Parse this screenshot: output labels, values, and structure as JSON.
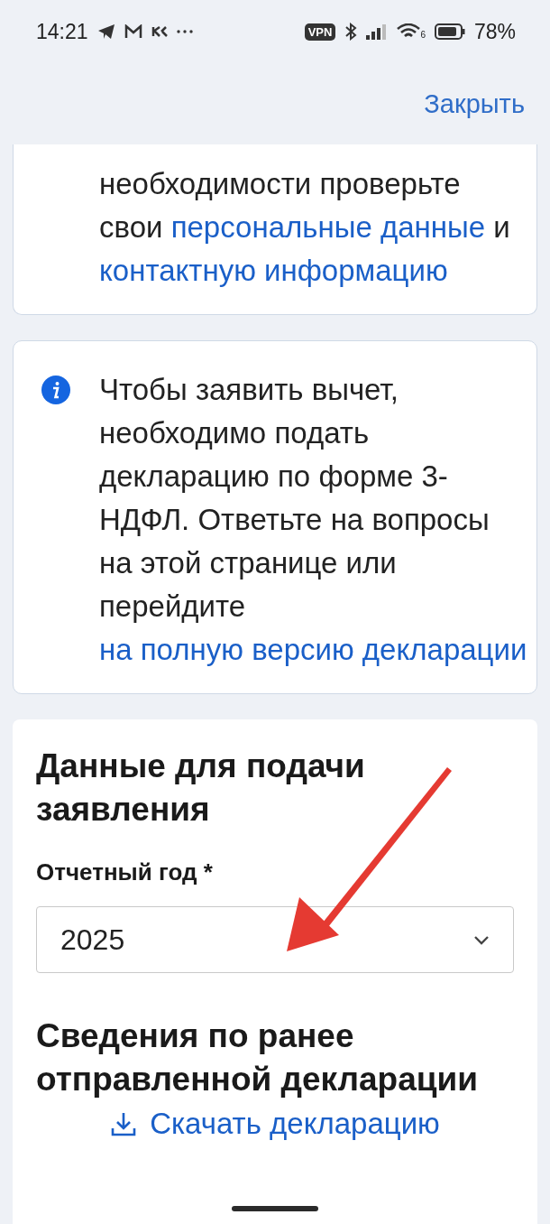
{
  "status_bar": {
    "time": "14:21",
    "vpn": "VPN",
    "wifi_badge": "6",
    "battery": "78%"
  },
  "header": {
    "close": "Закрыть"
  },
  "notices": [
    {
      "kind": "plain",
      "parts": [
        {
          "text": "необходимости проверьте свои ",
          "link": false
        },
        {
          "text": "персональные данные",
          "link": true
        },
        {
          "text": " и ",
          "link": false
        },
        {
          "text": "контактную информацию",
          "link": true
        }
      ]
    },
    {
      "kind": "info",
      "parts": [
        {
          "text": "Чтобы заявить вычет, необходимо подать декларацию по форме 3-НДФЛ. Ответьте на вопросы на этой странице или перейдите ",
          "link": false
        },
        {
          "text": "на полную версию декларации",
          "link": true
        }
      ]
    }
  ],
  "form": {
    "title": "Данные для подачи заявления",
    "field_label": "Отчетный год *",
    "field_value": "2025",
    "section_title": "Сведения по ранее отправленной декларации",
    "download": "Скачать декларацию"
  }
}
